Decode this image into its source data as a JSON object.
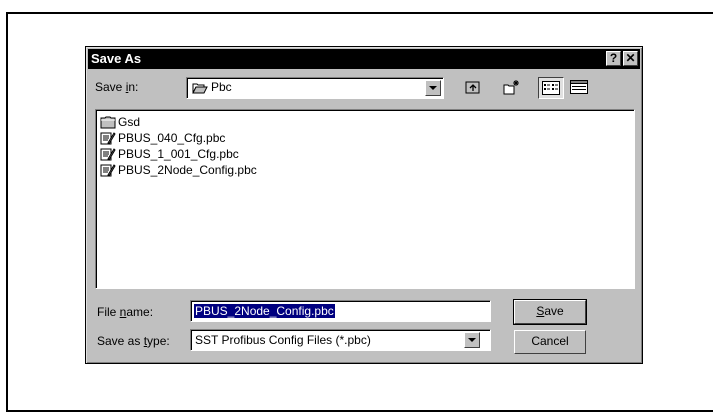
{
  "dialog": {
    "title": "Save As",
    "help_btn": "?",
    "close_btn": "✕"
  },
  "save_in": {
    "label_pre": "Save ",
    "label_key": "i",
    "label_post": "n:",
    "value": "Pbc"
  },
  "files": [
    {
      "name": "Gsd",
      "icon": "folder-icon"
    },
    {
      "name": "PBUS_040_Cfg.pbc",
      "icon": "config-file-icon"
    },
    {
      "name": "PBUS_1_001_Cfg.pbc",
      "icon": "config-file-icon"
    },
    {
      "name": "PBUS_2Node_Config.pbc",
      "icon": "config-file-icon"
    }
  ],
  "file_name": {
    "label_pre": "File ",
    "label_key": "n",
    "label_post": "ame:",
    "value": "PBUS_2Node_Config.pbc"
  },
  "save_type": {
    "label_pre": "Save as ",
    "label_key": "t",
    "label_post": "ype:",
    "value": "SST Profibus Config Files (*.pbc)"
  },
  "buttons": {
    "save_key": "S",
    "save_rest": "ave",
    "cancel": "Cancel"
  }
}
